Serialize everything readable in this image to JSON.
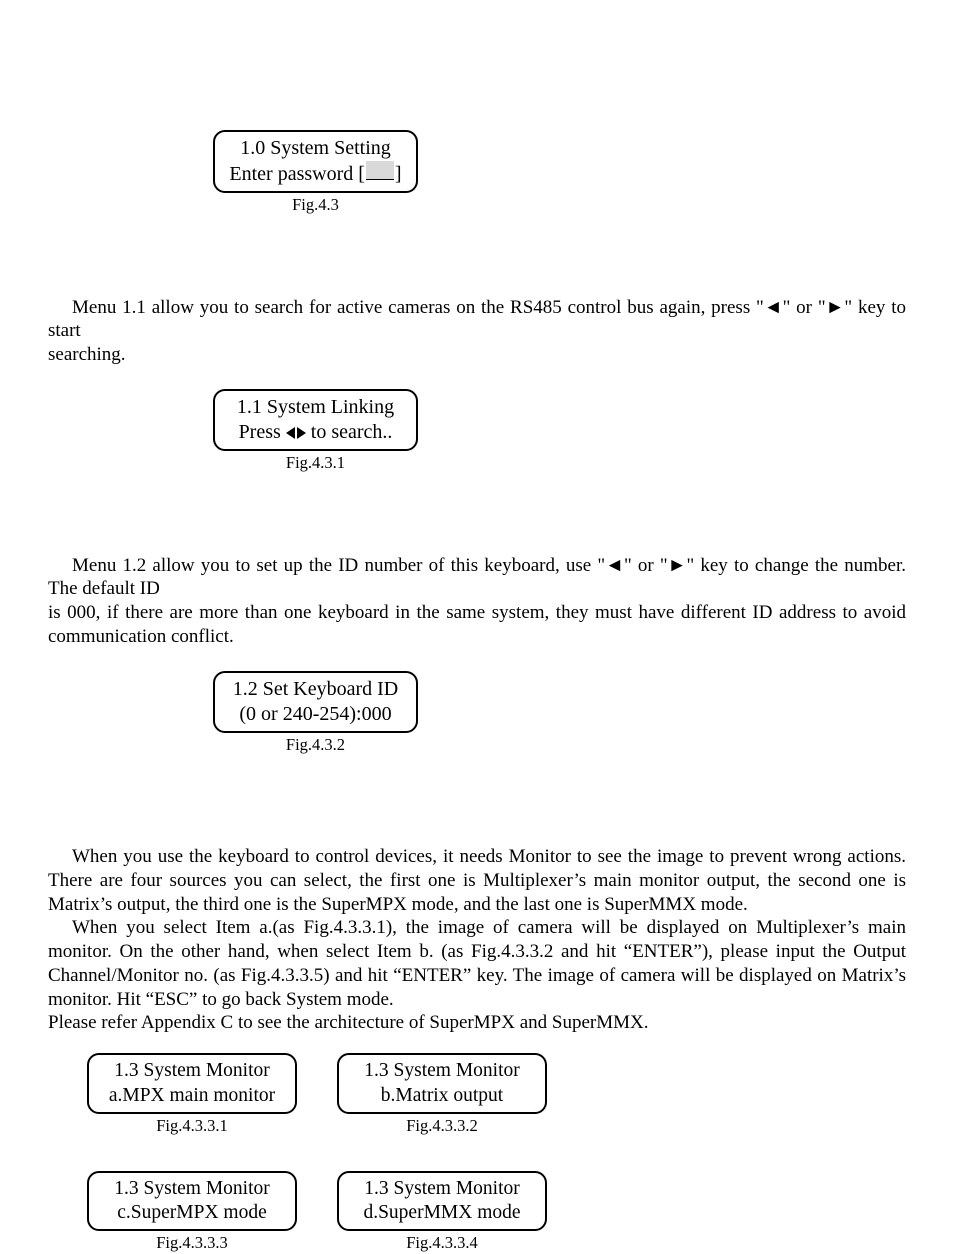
{
  "fig43": {
    "line1": "1.0 System Setting",
    "line2_pre": "Enter password [",
    "line2_post": "]",
    "caption": "Fig.4.3"
  },
  "para_menu11_a": "Menu 1.1 allow you to search for active cameras on the RS485 control bus again, press \"",
  "para_menu11_b": "\" or \"",
  "para_menu11_c": "\" key to start",
  "para_menu11_d": "searching.",
  "fig431": {
    "line1": "1.1 System Linking",
    "line2_pre": "Press ",
    "line2_post": " to search..",
    "caption": "Fig.4.3.1"
  },
  "para_menu12_a": "Menu 1.2 allow you to set up the ID number of this keyboard, use \"",
  "para_menu12_b": "\" or \"",
  "para_menu12_c": "\" key to change the number. The default ID",
  "para_menu12_d": "is 000, if there are more than one keyboard in the same  system, they must have different ID address to avoid communication conflict.",
  "fig432": {
    "line1": "1.2 Set Keyboard ID",
    "line2": "(0 or 240-254):000",
    "caption": "Fig.4.3.2"
  },
  "para13_a": "When you use the keyboard to control devices, it needs Monitor to see the image to prevent wrong actions. There are four sources you can select, the first one is Multiplexer’s main monitor output, the second one is Matrix’s output, the third one is the SuperMPX mode, and the last one is SuperMMX mode.",
  "para13_b": "When you select Item a.(as Fig.4.3.3.1), the image of camera will be displayed on Multiplexer’s main monitor. On the other hand, when select Item b. (as Fig.4.3.3.2 and hit “ENTER”), please input the Output Channel/Monitor no. (as Fig.4.3.3.5) and hit “ENTER” key. The image of camera will be displayed on Matrix’s monitor.  Hit “ESC” to go back System mode.",
  "para13_c": "Please refer Appendix C to see the architecture of SuperMPX and SuperMMX.",
  "grid": {
    "a": {
      "line1": "1.3 System Monitor",
      "line2": "a.MPX main monitor",
      "caption": "Fig.4.3.3.1"
    },
    "b": {
      "line1": "1.3 System Monitor",
      "line2": "b.Matrix output",
      "caption": "Fig.4.3.3.2"
    },
    "c": {
      "line1": "1.3 System Monitor",
      "line2": "c.SuperMPX mode",
      "caption": "Fig.4.3.3.3"
    },
    "d": {
      "line1": "1.3 System Monitor",
      "line2": "d.SuperMMX mode",
      "caption": "Fig.4.3.3.4"
    }
  },
  "glyphs": {
    "left": "◄",
    "right": "►"
  }
}
